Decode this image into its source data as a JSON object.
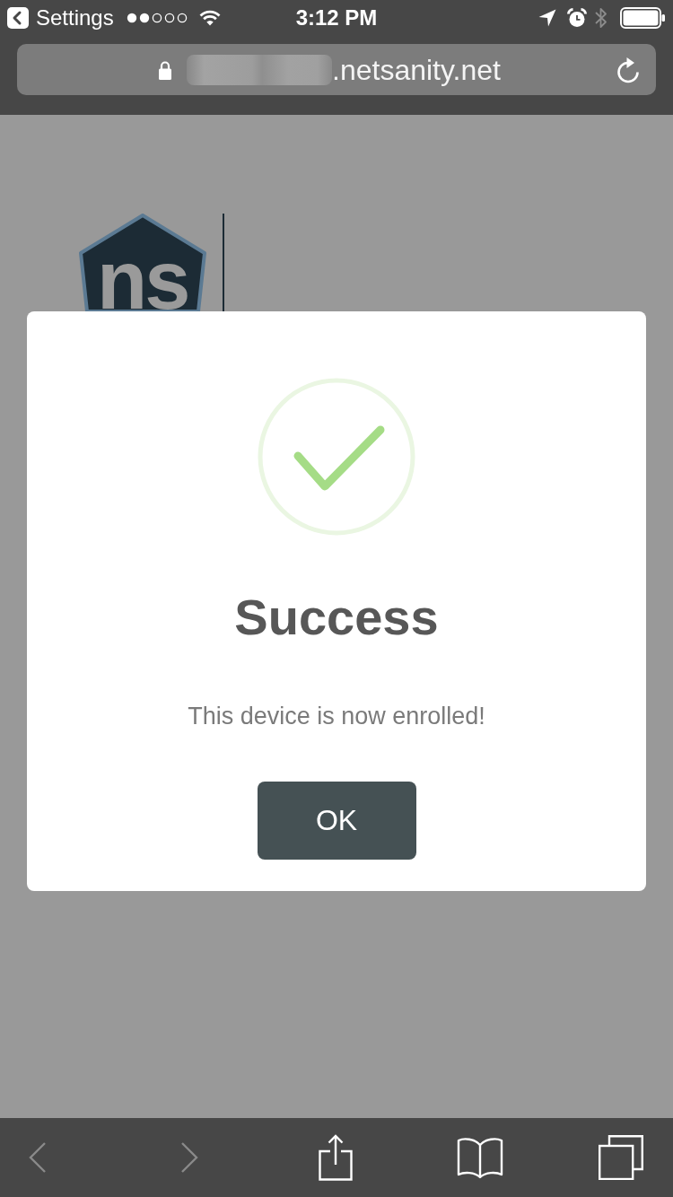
{
  "status_bar": {
    "back_label": "Settings",
    "time": "3:12 PM",
    "bluetooth_connected": false
  },
  "address_bar": {
    "url": ".netsanity.net"
  },
  "page": {
    "logo": {
      "monogram": "ns"
    }
  },
  "dialog": {
    "title": "Success",
    "message": "This device is now enrolled!",
    "button": "OK"
  },
  "toolbar": [
    {
      "kind": "back",
      "disabled": true
    },
    {
      "kind": "forward",
      "disabled": true
    },
    {
      "kind": "share",
      "disabled": false
    },
    {
      "kind": "bookmarks",
      "disabled": false
    },
    {
      "kind": "tabs",
      "disabled": false
    }
  ]
}
